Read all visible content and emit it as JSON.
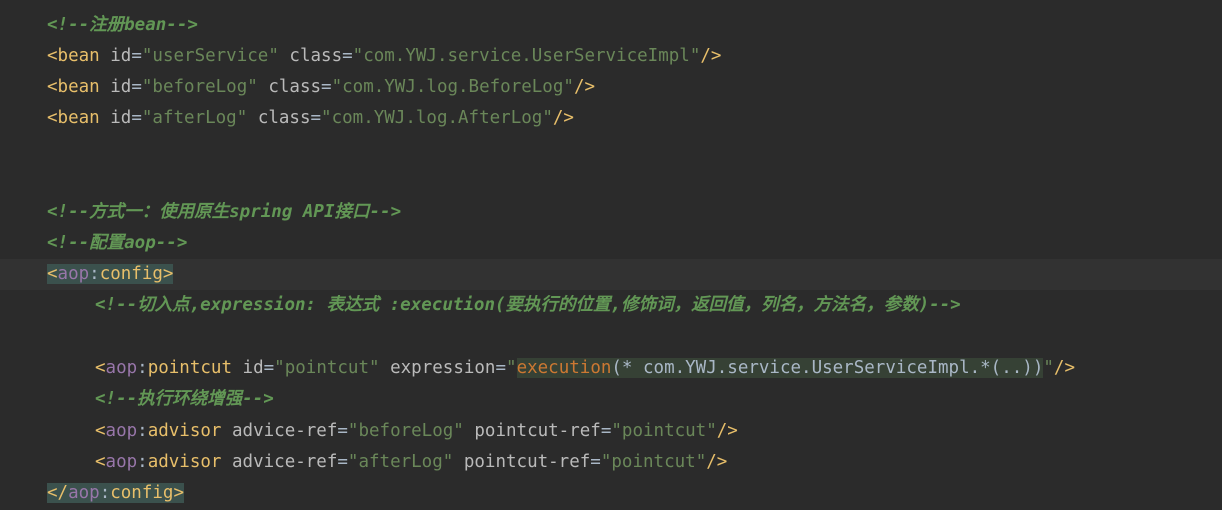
{
  "editor": {
    "lines": [
      {
        "comment": "<!--注册bean-->"
      },
      {
        "tag": "bean",
        "id_value": "userService",
        "class_value": "com.YWJ.service.UserServiceImpl"
      },
      {
        "tag": "bean",
        "id_value": "beforeLog",
        "class_value": "com.YWJ.log.BeforeLog"
      },
      {
        "tag": "bean",
        "id_value": "afterLog",
        "class_value": "com.YWJ.log.AfterLog"
      },
      {
        "comment": "<!--方式一：使用原生spring API接口-->"
      },
      {
        "comment": "<!--配置aop-->"
      },
      {
        "ns": "aop",
        "tag": "config"
      },
      {
        "comment": "<!--切入点,expression: 表达式 :execution(要执行的位置,修饰词，返回值，列名，方法名，参数)-->"
      },
      {
        "ns": "aop",
        "tag": "pointcut",
        "id_value": "pointcut",
        "expression_keyword": "execution",
        "expression_rest": "(* com.YWJ.service.UserServiceImpl.*(..))"
      },
      {
        "comment": "<!--执行环绕增强-->"
      },
      {
        "ns": "aop",
        "tag": "advisor",
        "advice_ref_value": "beforeLog",
        "pointcut_ref_value": "pointcut"
      },
      {
        "ns": "aop",
        "tag": "advisor",
        "advice_ref_value": "afterLog",
        "pointcut_ref_value": "pointcut"
      },
      {
        "ns": "aop",
        "tag": "config"
      }
    ],
    "attr_names": {
      "id": "id",
      "class": "class",
      "expression": "expression",
      "advice_ref": "advice-ref",
      "pointcut_ref": "pointcut-ref"
    },
    "colors": {
      "background": "#2b2b2b",
      "comment": "#629755",
      "tag": "#e8bf6a",
      "namespace": "#9876aa",
      "attribute": "#bababa",
      "value": "#6a8759",
      "keyword": "#cc7832"
    }
  }
}
